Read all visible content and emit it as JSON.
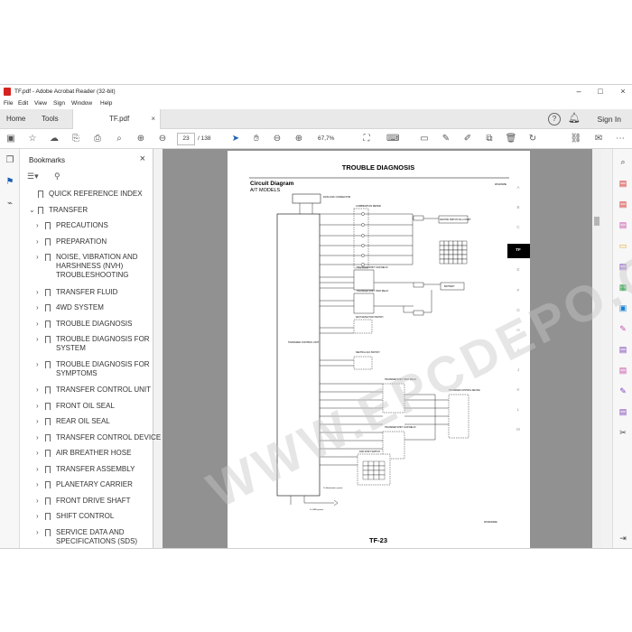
{
  "window": {
    "title": "TF.pdf - Adobe Acrobat Reader (32-bit)"
  },
  "menu": [
    "File",
    "Edit",
    "View",
    "Sign",
    "Window",
    "Help"
  ],
  "tabs": {
    "home": "Home",
    "tools": "Tools",
    "document": "TF.pdf"
  },
  "header": {
    "sign_in": "Sign In"
  },
  "toolbar": {
    "page_current": "23",
    "page_total": "/ 138",
    "zoom": "67,7%"
  },
  "bookmarks": {
    "title": "Bookmarks",
    "items": [
      {
        "label": "QUICK REFERENCE INDEX",
        "level": 0,
        "expand": ""
      },
      {
        "label": "TRANSFER",
        "level": 0,
        "expand": "v"
      },
      {
        "label": "PRECAUTIONS",
        "level": 1,
        "expand": ">"
      },
      {
        "label": "PREPARATION",
        "level": 1,
        "expand": ">"
      },
      {
        "label": "NOISE, VIBRATION AND\nHARSHNESS (NVH)\nTROUBLESHOOTING",
        "level": 1,
        "expand": ">"
      },
      {
        "label": "TRANSFER FLUID",
        "level": 1,
        "expand": ">"
      },
      {
        "label": "4WD SYSTEM",
        "level": 1,
        "expand": ">"
      },
      {
        "label": "TROUBLE DIAGNOSIS",
        "level": 1,
        "expand": ">"
      },
      {
        "label": "TROUBLE DIAGNOSIS FOR\nSYSTEM",
        "level": 1,
        "expand": ">"
      },
      {
        "label": "TROUBLE DIAGNOSIS FOR\nSYMPTOMS",
        "level": 1,
        "expand": ">"
      },
      {
        "label": "TRANSFER CONTROL UNIT",
        "level": 1,
        "expand": ">"
      },
      {
        "label": "FRONT OIL SEAL",
        "level": 1,
        "expand": ">"
      },
      {
        "label": "REAR OIL SEAL",
        "level": 1,
        "expand": ">"
      },
      {
        "label": "TRANSFER CONTROL DEVICE",
        "level": 1,
        "expand": ">"
      },
      {
        "label": "AIR BREATHER HOSE",
        "level": 1,
        "expand": ">"
      },
      {
        "label": "TRANSFER ASSEMBLY",
        "level": 1,
        "expand": ">"
      },
      {
        "label": "PLANETARY CARRIER",
        "level": 1,
        "expand": ">"
      },
      {
        "label": "FRONT DRIVE SHAFT",
        "level": 1,
        "expand": ">"
      },
      {
        "label": "SHIFT CONTROL",
        "level": 1,
        "expand": ">"
      },
      {
        "label": "SERVICE DATA AND\nSPECIFICATIONS (SDS)",
        "level": 1,
        "expand": ">"
      }
    ]
  },
  "document": {
    "header": "TROUBLE DIAGNOSIS",
    "section_title": "Circuit Diagram",
    "section_subtitle": "A/T MODELS",
    "section_tabs": [
      "A",
      "B",
      "C",
      "TF",
      "E",
      "F",
      "G",
      "H",
      "I",
      "J",
      "K",
      "L",
      "M"
    ],
    "active_tab": "TF",
    "footer": "TF-23",
    "labels": {
      "data_link": "DATA LINK CONNECTOR",
      "combination_meter": "COMBINATION METER",
      "ign_switch": "IGNITION SWITCH ON or START",
      "transfer_shift_low": "TRANSFER SHIFT LOW RELAY",
      "transfer_shift_high": "TRANSFER SHIFT HIGH RELAY",
      "battery": "BATTERY",
      "wait_detection": "WAIT DETECTION SWITCH",
      "control_unit": "TRANSFER CONTROL UNIT",
      "neutral_switch": "NEUTRAL 4LO SWITCH",
      "shift_high_relay": "TRANSFER SHIFT HIGH RELAY",
      "control_device": "TRANSFER CONTROL DEVICE",
      "shift_low_relay": "TRANSFER SHIFT LOW RELAY",
      "wd_shift_switch": "4WD SHIFT SWITCH",
      "illumination": "To illumination system",
      "can": "To CAN system"
    },
    "ref_top": "WKIA0915E",
    "ref_bottom": "WCWA0090E"
  },
  "watermark": "WWW.EPCDEPO.COM",
  "colors": {
    "acrobat_red": "#d5231f",
    "doc_bg": "#919191",
    "active_tab": "#000000"
  }
}
